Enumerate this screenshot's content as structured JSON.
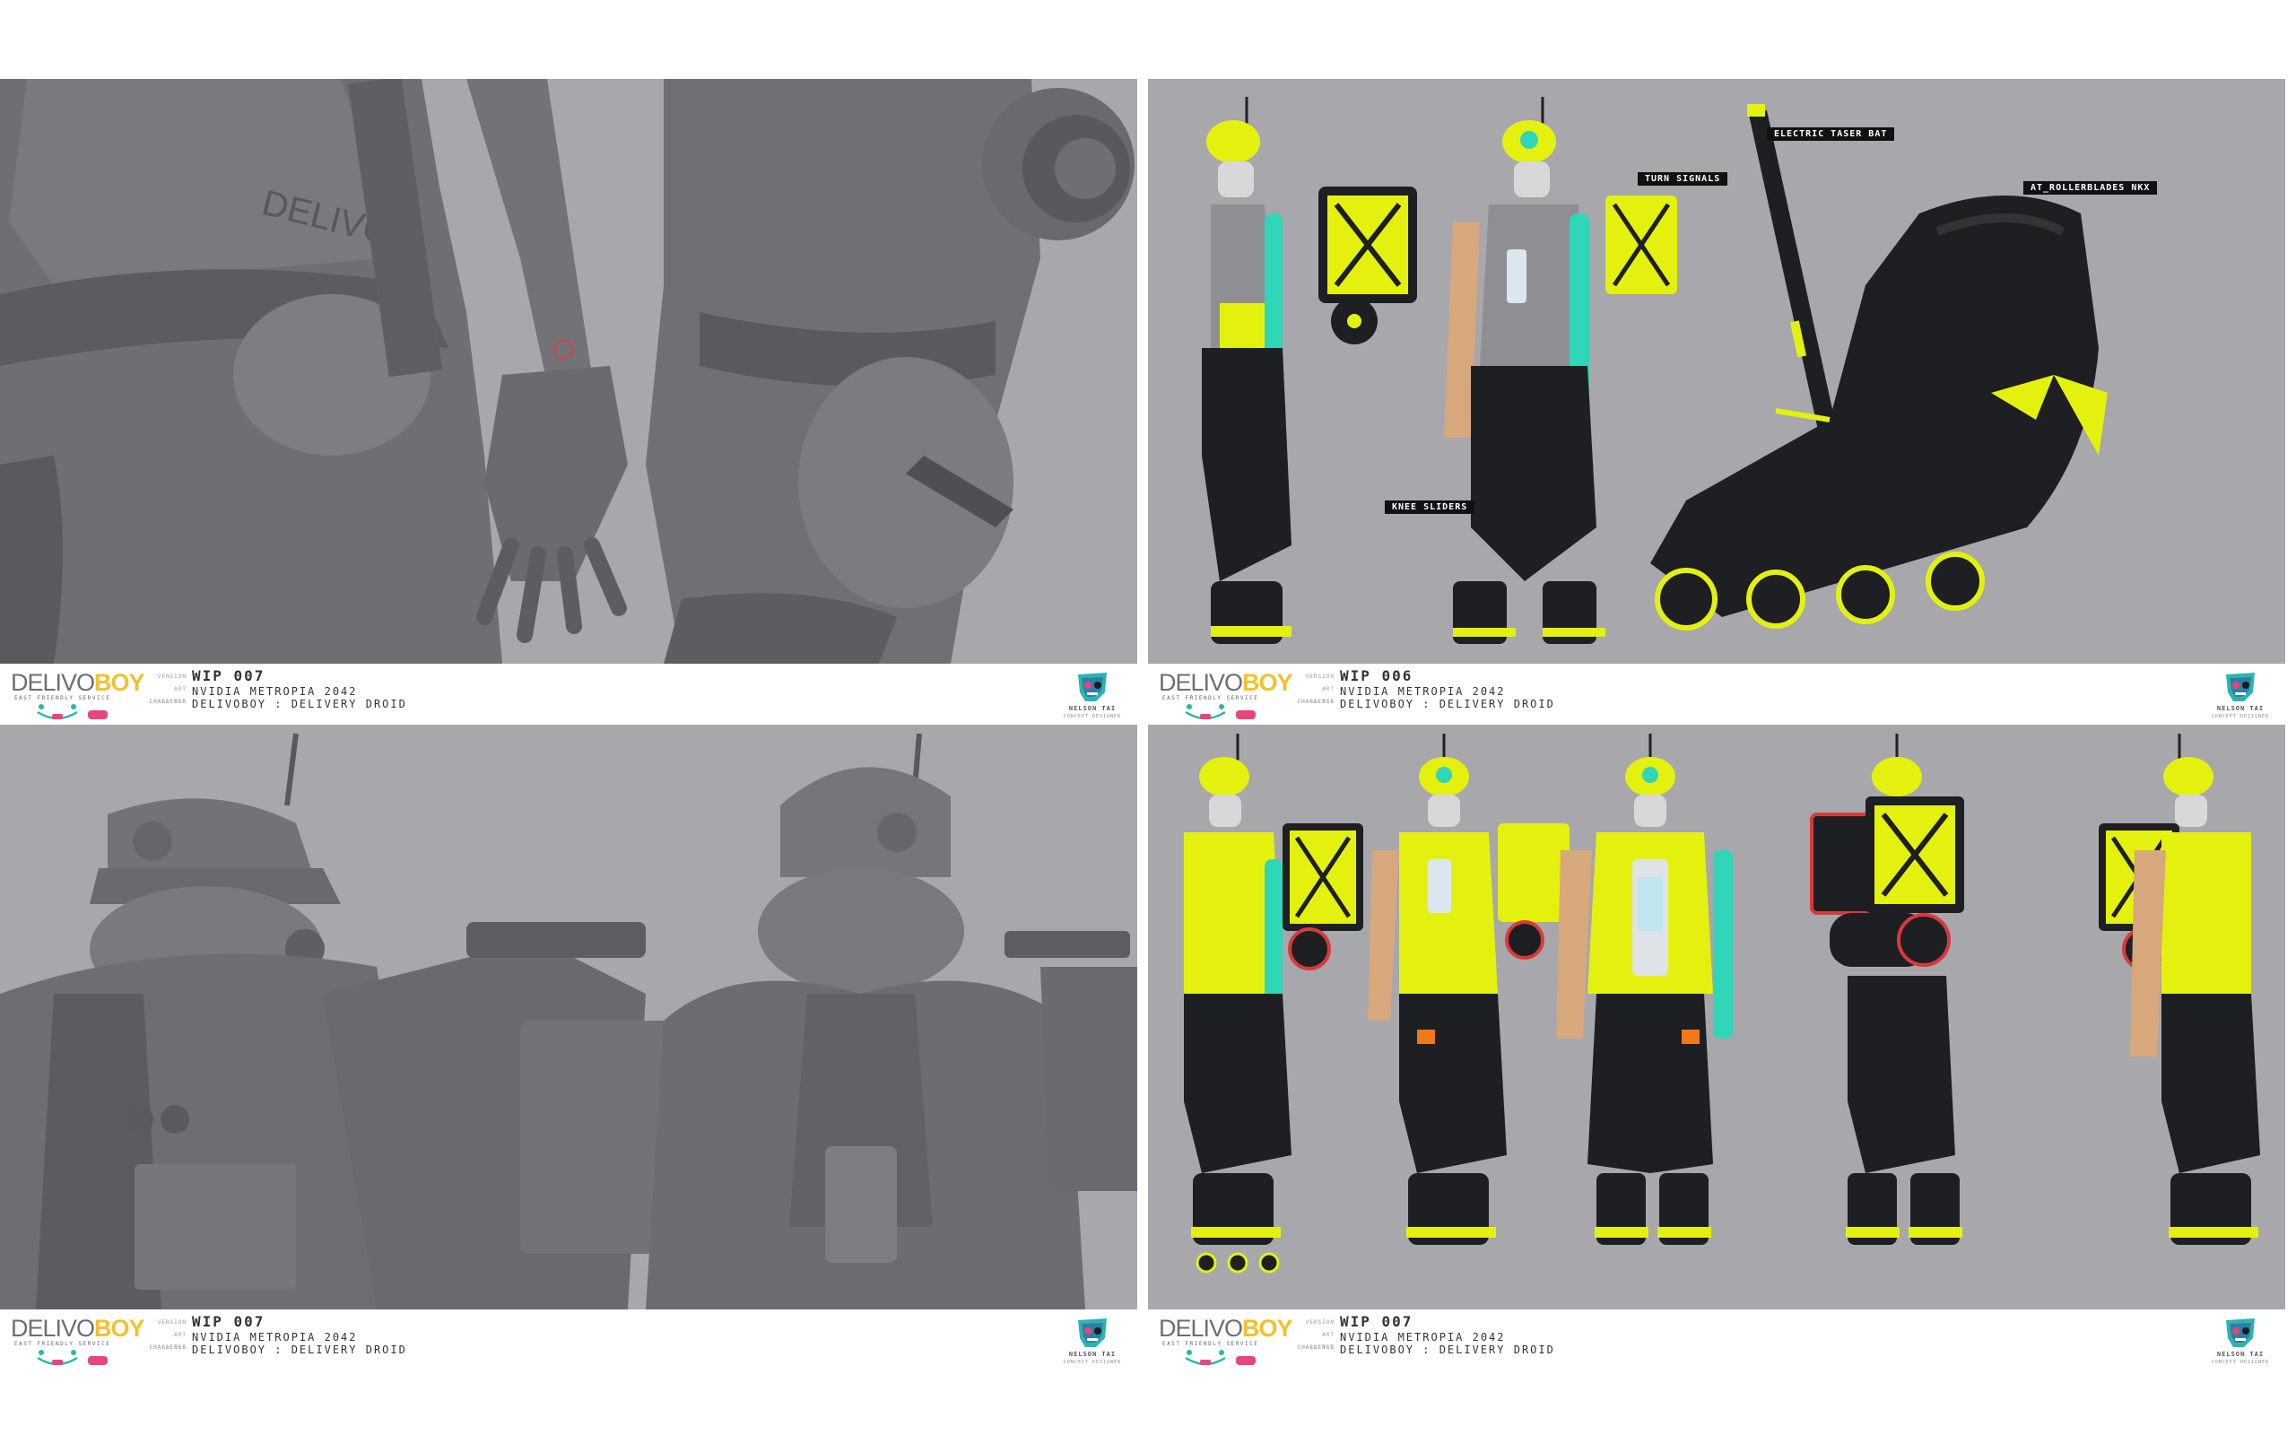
{
  "sheets": [
    {
      "brand": {
        "word_a": "DELIVO",
        "word_b": "BOY",
        "tagline": "EAST FRIENDLY SERVICE"
      },
      "labels": {
        "version": "VERSION",
        "challenge": "ART CHALLENGE",
        "character": "CHARACTER"
      },
      "version": "WIP 007",
      "challenge": "NVIDIA METROPIA 2042",
      "character": "DELIVOBOY : DELIVERY DROID",
      "author": {
        "name": "NELSON TAI",
        "title": "CONCEPT DESIGNER"
      }
    },
    {
      "brand": {
        "word_a": "DELIVO",
        "word_b": "BOY",
        "tagline": "EAST FRIENDLY SERVICE"
      },
      "labels": {
        "version": "VERSION",
        "challenge": "ART CHALLENGE",
        "character": "CHARACTER"
      },
      "version": "WIP 006",
      "challenge": "NVIDIA METROPIA 2042",
      "character": "DELIVOBOY : DELIVERY DROID",
      "author": {
        "name": "NELSON TAI",
        "title": "CONCEPT DESIGNER"
      },
      "callouts": [
        "TURN SIGNALS",
        "KNEE SLIDERS",
        "ELECTRIC TASER BAT",
        "AT_ROLLERBLADES NKX"
      ]
    },
    {
      "brand": {
        "word_a": "DELIVO",
        "word_b": "BOY",
        "tagline": "EAST FRIENDLY SERVICE"
      },
      "labels": {
        "version": "VERSION",
        "challenge": "ART CHALLENGE",
        "character": "CHARACTER"
      },
      "version": "WIP 007",
      "challenge": "NVIDIA METROPIA 2042",
      "character": "DELIVOBOY : DELIVERY DROID",
      "author": {
        "name": "NELSON TAI",
        "title": "CONCEPT DESIGNER"
      }
    },
    {
      "brand": {
        "word_a": "DELIVO",
        "word_b": "BOY",
        "tagline": "EAST FRIENDLY SERVICE"
      },
      "labels": {
        "version": "VERSION",
        "challenge": "ART CHALLENGE",
        "character": "CHARACTER"
      },
      "version": "WIP 007",
      "challenge": "NVIDIA METROPIA 2042",
      "character": "DELIVOBOY : DELIVERY DROID",
      "author": {
        "name": "NELSON TAI",
        "title": "CONCEPT DESIGNER"
      }
    }
  ],
  "colors": {
    "backdrop": "#a7a7ac",
    "sculpt": "#6e6e72",
    "accent_yellow": "#e4f10f",
    "accent_teal": "#2fd6b8",
    "suit_black": "#1e1f22",
    "brand_yellow": "#f1c22c",
    "brand_pink": "#e8457a",
    "brand_teal": "#2bb5b0"
  },
  "icons": [
    "delivoboy-logo",
    "robot-face-mark-icon",
    "nelson-tai-skull-logo-icon"
  ]
}
